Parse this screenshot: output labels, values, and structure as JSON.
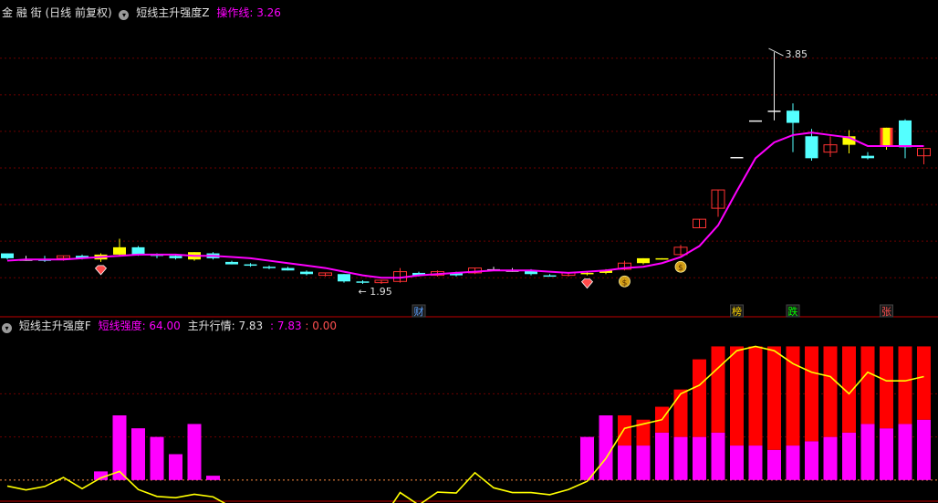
{
  "upper_header": {
    "title": "金 融 街 (日线 前复权)",
    "indicator": "短线主升强度Z",
    "line_label": "操作线: 3.26"
  },
  "lower_header": {
    "indicator": "短线主升强度F",
    "short_label": "短线强度: 64.00",
    "main_label": "主升行情: 7.83",
    "val2": ": 7.83",
    "val3": ": 0.00"
  },
  "colors": {
    "up_candle": "#ff3232",
    "down_candle": "#54ffff",
    "signal_candle": "#ffff00",
    "operation_line": "#ff00ff",
    "short_strength_bar": "#ff00ff",
    "main_rise_bar": "#ff0000",
    "short_line": "#ffff00"
  },
  "chart_data": [
    {
      "type": "candlestick",
      "title": "短线主升强度Z",
      "ylim": [
        1.77,
        4.15
      ],
      "annotations": {
        "high": "3.85",
        "low": "1.95"
      },
      "markers": [
        {
          "label": "财",
          "index": 22,
          "color": "#5aa0ff"
        },
        {
          "label": "榜",
          "index": 39,
          "color": "#ffd700"
        },
        {
          "label": "跌",
          "index": 42,
          "color": "#00ff00"
        },
        {
          "label": "张",
          "index": 47,
          "color": "#ff5050"
        }
      ],
      "icons": [
        {
          "name": "diamond-icon",
          "index": 5
        },
        {
          "name": "diamond-icon",
          "index": 31
        },
        {
          "name": "money-bag-icon",
          "index": 33
        },
        {
          "name": "money-bag-icon",
          "index": 36
        }
      ],
      "candles": [
        {
          "o": 2.2,
          "c": 2.16,
          "h": 2.2,
          "l": 2.15,
          "k": "down"
        },
        {
          "o": 2.15,
          "c": 2.15,
          "h": 2.18,
          "l": 2.14,
          "k": "flat"
        },
        {
          "o": 2.14,
          "c": 2.15,
          "h": 2.18,
          "l": 2.13,
          "k": "down"
        },
        {
          "o": 2.16,
          "c": 2.18,
          "h": 2.18,
          "l": 2.14,
          "k": "up"
        },
        {
          "o": 2.16,
          "c": 2.18,
          "h": 2.19,
          "l": 2.15,
          "k": "down"
        },
        {
          "o": 2.15,
          "c": 2.19,
          "h": 2.2,
          "l": 2.13,
          "k": "sig"
        },
        {
          "o": 2.19,
          "c": 2.25,
          "h": 2.32,
          "l": 2.18,
          "k": "sig"
        },
        {
          "o": 2.25,
          "c": 2.19,
          "h": 2.26,
          "l": 2.18,
          "k": "down"
        },
        {
          "o": 2.19,
          "c": 2.18,
          "h": 2.2,
          "l": 2.16,
          "k": "down"
        },
        {
          "o": 2.18,
          "c": 2.16,
          "h": 2.19,
          "l": 2.15,
          "k": "down"
        },
        {
          "o": 2.15,
          "c": 2.21,
          "h": 2.21,
          "l": 2.14,
          "k": "sig"
        },
        {
          "o": 2.2,
          "c": 2.16,
          "h": 2.21,
          "l": 2.15,
          "k": "down"
        },
        {
          "o": 2.13,
          "c": 2.11,
          "h": 2.14,
          "l": 2.11,
          "k": "down"
        },
        {
          "o": 2.11,
          "c": 2.1,
          "h": 2.12,
          "l": 2.09,
          "k": "down"
        },
        {
          "o": 2.09,
          "c": 2.08,
          "h": 2.1,
          "l": 2.07,
          "k": "down"
        },
        {
          "o": 2.08,
          "c": 2.06,
          "h": 2.09,
          "l": 2.06,
          "k": "down"
        },
        {
          "o": 2.05,
          "c": 2.03,
          "h": 2.06,
          "l": 2.02,
          "k": "down"
        },
        {
          "o": 2.02,
          "c": 2.04,
          "h": 2.04,
          "l": 2.01,
          "k": "up"
        },
        {
          "o": 2.03,
          "c": 1.97,
          "h": 2.03,
          "l": 1.96,
          "k": "down"
        },
        {
          "o": 1.97,
          "c": 1.96,
          "h": 1.98,
          "l": 1.95,
          "k": "down"
        },
        {
          "o": 1.96,
          "c": 1.98,
          "h": 1.98,
          "l": 1.95,
          "k": "up"
        },
        {
          "o": 1.97,
          "c": 2.05,
          "h": 2.08,
          "l": 1.96,
          "k": "up"
        },
        {
          "o": 2.02,
          "c": 2.04,
          "h": 2.05,
          "l": 2.01,
          "k": "down"
        },
        {
          "o": 2.02,
          "c": 2.05,
          "h": 2.06,
          "l": 2.01,
          "k": "up"
        },
        {
          "o": 2.04,
          "c": 2.02,
          "h": 2.05,
          "l": 2.01,
          "k": "down"
        },
        {
          "o": 2.04,
          "c": 2.08,
          "h": 2.08,
          "l": 2.03,
          "k": "up"
        },
        {
          "o": 2.07,
          "c": 2.07,
          "h": 2.09,
          "l": 2.06,
          "k": "flat"
        },
        {
          "o": 2.06,
          "c": 2.06,
          "h": 2.08,
          "l": 2.05,
          "k": "flat"
        },
        {
          "o": 2.06,
          "c": 2.03,
          "h": 2.07,
          "l": 2.02,
          "k": "down"
        },
        {
          "o": 2.02,
          "c": 2.02,
          "h": 2.03,
          "l": 2.01,
          "k": "down"
        },
        {
          "o": 2.02,
          "c": 2.04,
          "h": 2.04,
          "l": 2.01,
          "k": "up"
        },
        {
          "o": 2.03,
          "c": 2.04,
          "h": 2.05,
          "l": 2.02,
          "k": "sig"
        },
        {
          "o": 2.04,
          "c": 2.06,
          "h": 2.07,
          "l": 2.03,
          "k": "sig"
        },
        {
          "o": 2.07,
          "c": 2.12,
          "h": 2.14,
          "l": 2.06,
          "k": "up"
        },
        {
          "o": 2.12,
          "c": 2.16,
          "h": 2.16,
          "l": 2.11,
          "k": "sig"
        },
        {
          "o": 2.15,
          "c": 2.16,
          "h": 2.16,
          "l": 2.15,
          "k": "sig"
        },
        {
          "o": 2.19,
          "c": 2.25,
          "h": 2.27,
          "l": 2.18,
          "k": "up"
        },
        {
          "o": 2.41,
          "c": 2.48,
          "h": 2.48,
          "l": 2.41,
          "k": "up"
        },
        {
          "o": 2.57,
          "c": 2.72,
          "h": 2.72,
          "l": 2.5,
          "k": "up"
        },
        {
          "o": 2.99,
          "c": 2.99,
          "h": 2.99,
          "l": 2.99,
          "k": "flat"
        },
        {
          "o": 3.29,
          "c": 3.29,
          "h": 3.29,
          "l": 3.29,
          "k": "flat"
        },
        {
          "o": 3.37,
          "c": 3.37,
          "h": 3.85,
          "l": 3.29,
          "k": "flat"
        },
        {
          "o": 3.37,
          "c": 3.27,
          "h": 3.43,
          "l": 3.03,
          "k": "down"
        },
        {
          "o": 3.16,
          "c": 2.98,
          "h": 3.22,
          "l": 2.96,
          "k": "down"
        },
        {
          "o": 3.03,
          "c": 3.09,
          "h": 3.16,
          "l": 2.99,
          "k": "up"
        },
        {
          "o": 3.09,
          "c": 3.16,
          "h": 3.21,
          "l": 3.02,
          "k": "sig"
        },
        {
          "o": 3.0,
          "c": 2.98,
          "h": 3.03,
          "l": 2.97,
          "k": "down"
        },
        {
          "o": 3.08,
          "c": 3.23,
          "h": 3.23,
          "l": 3.05,
          "k": "sig"
        },
        {
          "o": 3.29,
          "c": 3.07,
          "h": 3.3,
          "l": 2.98,
          "k": "down"
        },
        {
          "o": 3.0,
          "c": 3.06,
          "h": 3.06,
          "l": 2.93,
          "k": "up"
        }
      ],
      "series": [
        {
          "name": "操作线",
          "values": [
            2.14,
            2.15,
            2.15,
            2.15,
            2.16,
            2.17,
            2.18,
            2.19,
            2.19,
            2.19,
            2.18,
            2.18,
            2.17,
            2.16,
            2.14,
            2.12,
            2.1,
            2.08,
            2.05,
            2.02,
            2.0,
            2.0,
            2.02,
            2.03,
            2.04,
            2.05,
            2.06,
            2.06,
            2.06,
            2.05,
            2.04,
            2.05,
            2.06,
            2.08,
            2.09,
            2.12,
            2.17,
            2.26,
            2.43,
            2.71,
            2.98,
            3.11,
            3.17,
            3.19,
            3.17,
            3.15,
            3.08,
            3.08,
            3.08,
            3.08
          ]
        }
      ]
    },
    {
      "type": "bar",
      "title": "短线主升强度F",
      "ylim": [
        -3,
        33
      ],
      "series": [
        {
          "name": "短线强度",
          "values": [
            0,
            0,
            0,
            0,
            0,
            2,
            15,
            12,
            10,
            6,
            13,
            1,
            0,
            0,
            0,
            0,
            0,
            0,
            0,
            0,
            0,
            0,
            0,
            0,
            0,
            0,
            0,
            0,
            0,
            0,
            0,
            10,
            15,
            15,
            14,
            17,
            21,
            28,
            31,
            31,
            31,
            31,
            31,
            31,
            31,
            31,
            31,
            31,
            31,
            31
          ]
        },
        {
          "name": "主升行情",
          "values": [
            0,
            0,
            0,
            0,
            0,
            0,
            0,
            0,
            0,
            0,
            0,
            0,
            0,
            0,
            0,
            0,
            0,
            0,
            0,
            0,
            0,
            0,
            0,
            0,
            0,
            0,
            0,
            0,
            0,
            0,
            0,
            0,
            0,
            7,
            6,
            6,
            11,
            18,
            20,
            23,
            23,
            24,
            23,
            22,
            21,
            20,
            18,
            19,
            18,
            17
          ]
        },
        {
          "name": "短线强度线",
          "values": [
            -1.4,
            -2.3,
            -1.5,
            0.6,
            -2,
            0.5,
            2,
            -2.2,
            -3.8,
            -4.1,
            -3.3,
            -3.9,
            -6.3,
            -6.5,
            -5.8,
            -6.4,
            -7.2,
            -6.0,
            -9.4,
            -10.6,
            -9.4,
            -2.9,
            -5.8,
            -2.8,
            -3.0,
            1.7,
            -1.8,
            -2.9,
            -2.9,
            -3.4,
            -2.2,
            -0.3,
            5,
            12,
            13,
            14,
            20,
            22,
            26,
            30,
            31,
            30,
            27,
            25,
            24,
            20,
            25,
            23,
            23,
            24
          ]
        }
      ]
    }
  ]
}
